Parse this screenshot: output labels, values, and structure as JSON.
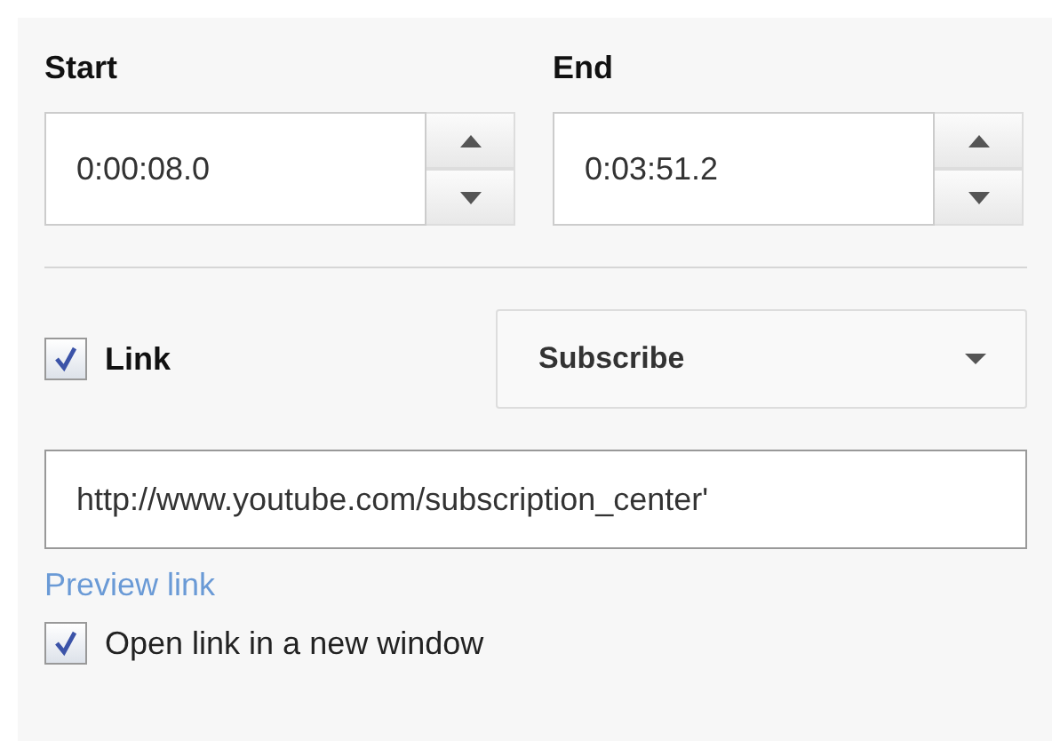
{
  "time_fields": [
    {
      "label": "Start",
      "value": "0:00:08.0"
    },
    {
      "label": "End",
      "value": "0:03:51.2"
    }
  ],
  "link": {
    "label": "Link",
    "checked": true,
    "type_dropdown": "Subscribe",
    "url": "http://www.youtube.com/subscription_center'",
    "preview": "Preview link"
  },
  "new_window": {
    "label": "Open link in a new window",
    "checked": true
  }
}
